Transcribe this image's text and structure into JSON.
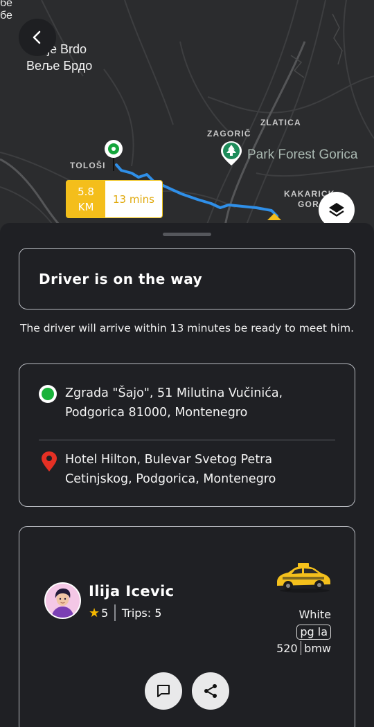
{
  "map": {
    "labels": {
      "top_partial_1": "бе",
      "top_partial_2": "бе",
      "place_latin": "je Brdo",
      "place_cyrillic": "Веље Брдо",
      "tolosi": "TOLOŠI",
      "zagoric": "ZAGORIČ",
      "zlatica": "ZLATICA",
      "park": "Park Forest Gorica",
      "kakaricka_1": "KAKARICK",
      "kakaricka_2": "GOR"
    },
    "eta": {
      "distance_value": "5.8",
      "distance_unit": "KM",
      "duration": "13 mins"
    },
    "icons": {
      "back": "chevron-left-icon",
      "layers": "layers-icon",
      "park": "tree-pin-icon"
    },
    "colors": {
      "route": "#2f8fe8",
      "origin": "#14a53b",
      "eta_accent": "#f4be1b"
    }
  },
  "status": {
    "title": "Driver is on the way",
    "message": "The driver will arrive within 13 minutes be ready to meet him."
  },
  "route": {
    "pickup_line1": "Zgrada \"Šajo\", 51 Milutina Vučinića,",
    "pickup_line2": "Podgorica 81000, Montenegro",
    "dropoff_line1": "Hotel Hilton, Bulevar Svetog Petra",
    "dropoff_line2": "Cetinjskog, Podgorica, Montenegro"
  },
  "driver": {
    "name": "Ilija Icevic",
    "rating": "5",
    "trips_label": "Trips: 5",
    "car_color": "White",
    "plate": "pg la",
    "car_number": "520",
    "car_make": "bmw"
  },
  "actions": {
    "chat_icon": "chat-icon",
    "share_icon": "share-icon"
  }
}
